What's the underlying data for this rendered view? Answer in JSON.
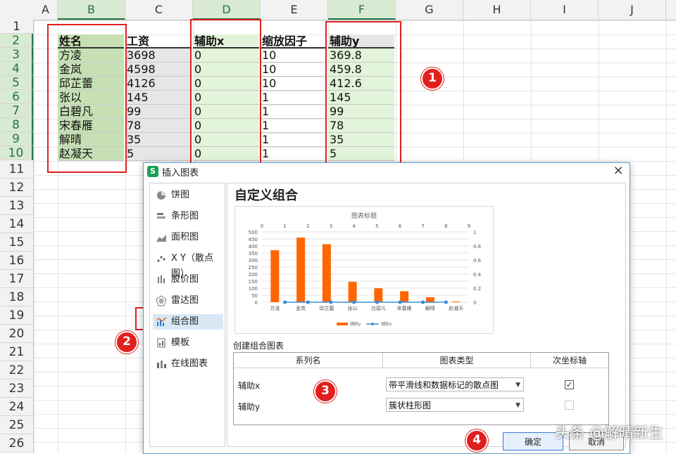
{
  "columns": [
    "A",
    "B",
    "C",
    "D",
    "E",
    "F",
    "G",
    "H",
    "I",
    "J"
  ],
  "rows": [
    "1",
    "2",
    "3",
    "4",
    "5",
    "6",
    "7",
    "8",
    "9",
    "10",
    "11",
    "12",
    "13",
    "14",
    "15",
    "16",
    "17",
    "18",
    "19",
    "20",
    "21",
    "22",
    "23",
    "24",
    "25",
    "26"
  ],
  "table": {
    "headers": [
      "姓名",
      "工资",
      "辅助x",
      "缩放因子",
      "辅助y"
    ],
    "rows": [
      [
        "方凌",
        "3698",
        "0",
        "10",
        "369.8"
      ],
      [
        "金岚",
        "4598",
        "0",
        "10",
        "459.8"
      ],
      [
        "邱芷蕾",
        "4126",
        "0",
        "10",
        "412.6"
      ],
      [
        "张以",
        "145",
        "0",
        "1",
        "145"
      ],
      [
        "白碧凡",
        "99",
        "0",
        "1",
        "99"
      ],
      [
        "宋春雁",
        "78",
        "0",
        "1",
        "78"
      ],
      [
        "解晴",
        "35",
        "0",
        "1",
        "35"
      ],
      [
        "赵凝天",
        "5",
        "0",
        "1",
        "5"
      ]
    ]
  },
  "badges": [
    "1",
    "2",
    "3",
    "4"
  ],
  "dialog": {
    "icon_letter": "S",
    "title": "插入图表",
    "close": "×",
    "nav": [
      {
        "label": "饼图",
        "icon": "pie-chart-icon"
      },
      {
        "label": "条形图",
        "icon": "bar-chart-icon"
      },
      {
        "label": "面积图",
        "icon": "area-chart-icon"
      },
      {
        "label": "X Y（散点图）",
        "icon": "scatter-chart-icon"
      },
      {
        "label": "股价图",
        "icon": "stock-chart-icon"
      },
      {
        "label": "雷达图",
        "icon": "radar-chart-icon"
      },
      {
        "label": "组合图",
        "icon": "combo-chart-icon"
      },
      {
        "label": "模板",
        "icon": "template-icon"
      },
      {
        "label": "在线图表",
        "icon": "online-chart-icon"
      }
    ],
    "active_nav": 6,
    "main_title": "自定义组合",
    "combo_label": "创建组合图表",
    "combo_headers": [
      "系列名",
      "图表类型",
      "次坐标轴"
    ],
    "combo_rows": [
      {
        "name": "辅助x",
        "type": "带平滑线和数据标记的散点图",
        "secondary": true
      },
      {
        "name": "辅助y",
        "type": "簇状柱形图",
        "secondary": false
      }
    ],
    "ok": "确定",
    "cancel": "取消"
  },
  "chart_data": {
    "type": "bar",
    "title": "图表标题",
    "categories": [
      "方凌",
      "金岚",
      "邱芷蕾",
      "张以",
      "白碧凡",
      "宋春雁",
      "解晴",
      "赵凝天"
    ],
    "series": [
      {
        "name": "辅助y",
        "type": "bar",
        "values": [
          369.8,
          459.8,
          412.6,
          145,
          99,
          78,
          35,
          5
        ],
        "color": "#ff6600"
      },
      {
        "name": "辅助x",
        "type": "scatter",
        "values": [
          0,
          0,
          0,
          0,
          0,
          0,
          0,
          0
        ],
        "color": "#3c8fd6"
      }
    ],
    "yticks": [
      "0",
      "50",
      "100",
      "150",
      "200",
      "250",
      "300",
      "350",
      "400",
      "450",
      "500"
    ],
    "ylim": [
      0,
      500
    ],
    "x2ticks": [
      "0",
      "1",
      "2",
      "3",
      "4",
      "5",
      "6",
      "7",
      "8",
      "9"
    ],
    "y2ticks": [
      "0",
      "0.2",
      "0.4",
      "0.6",
      "0.8",
      "1"
    ],
    "y2lim": [
      0,
      1
    ],
    "legend": "bottom"
  },
  "watermark": "头条 @解晴新生"
}
